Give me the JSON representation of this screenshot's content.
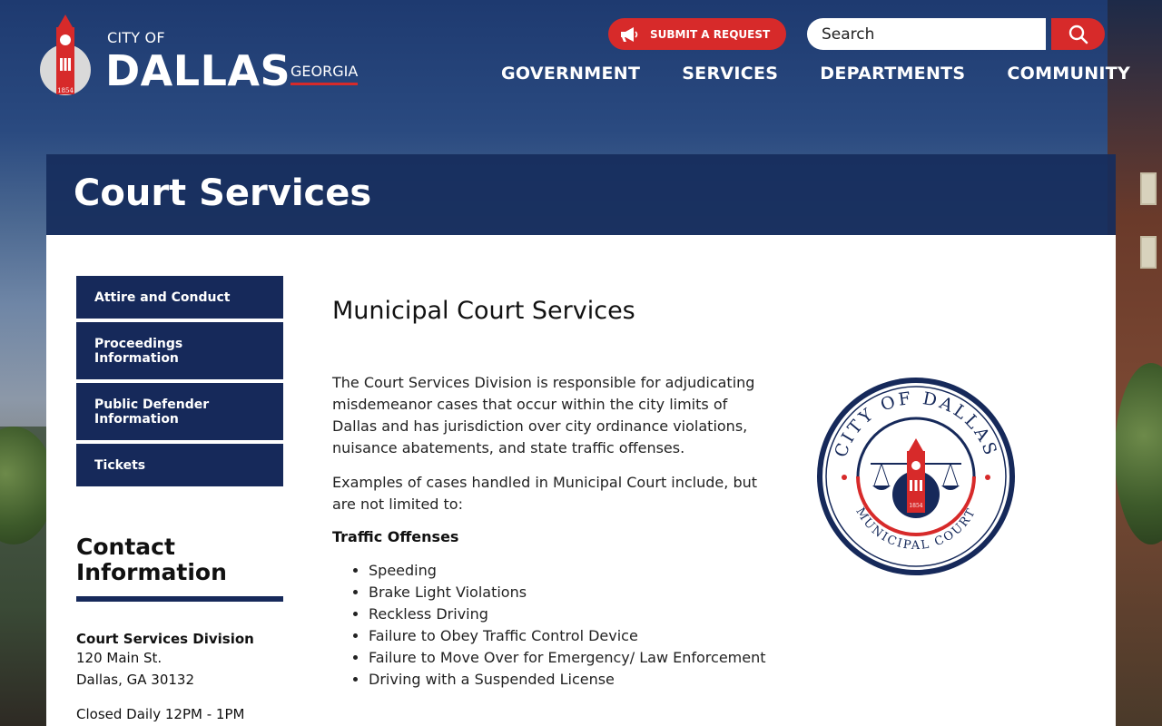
{
  "header": {
    "logo": {
      "city_of": "CITY OF",
      "name": "DALLAS",
      "state": "GEORGIA",
      "seal_year": "1854"
    },
    "submit_request_label": "SUBMIT A REQUEST",
    "search": {
      "placeholder": "Search",
      "value": ""
    },
    "nav": [
      {
        "label": "GOVERNMENT"
      },
      {
        "label": "SERVICES"
      },
      {
        "label": "DEPARTMENTS"
      },
      {
        "label": "COMMUNITY"
      }
    ]
  },
  "page_title": "Court Services",
  "sidebar": {
    "items": [
      {
        "label": "Attire and Conduct"
      },
      {
        "label": "Proceedings Information"
      },
      {
        "label": "Public Defender Information"
      },
      {
        "label": "Tickets"
      }
    ]
  },
  "contact": {
    "heading": "Contact Information",
    "division": "Court Services Division",
    "address_line1": "120 Main St.",
    "address_line2": "Dallas, GA 30132",
    "hours": "Closed Daily 12PM - 1PM"
  },
  "main": {
    "heading": "Municipal Court Services",
    "paragraph1": "The Court Services Division is responsible for adjudicating misdemeanor cases that occur within the city limits of Dallas and has jurisdiction over city ordinance violations, nuisance abatements, and state traffic offenses.",
    "paragraph2": "Examples of cases handled in Municipal Court include, but are not limited to:",
    "subheading": "Traffic Offenses",
    "list": [
      "Speeding",
      "Brake Light Violations",
      "Reckless Driving",
      "Failure to Obey Traffic Control Device",
      "Failure to Move Over for Emergency/ Law Enforcement",
      "Driving with a Suspended License"
    ]
  },
  "court_seal": {
    "top_text": "CITY OF DALLAS",
    "bottom_text": "MUNICIPAL COURT",
    "year": "1854"
  },
  "colors": {
    "navy": "#16295a",
    "red": "#d72a2a",
    "white": "#ffffff"
  }
}
